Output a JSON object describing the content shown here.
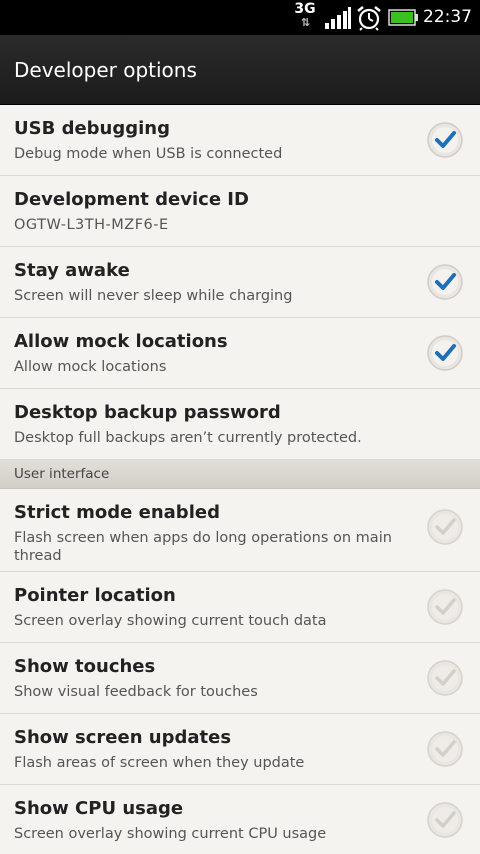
{
  "status_bar": {
    "network": "3G",
    "time": "22:37",
    "icons": [
      "network-3g-icon",
      "signal-icon",
      "alarm-icon",
      "battery-icon"
    ]
  },
  "header": {
    "title": "Developer options"
  },
  "items": [
    {
      "title": "USB debugging",
      "summary": "Debug mode when USB is connected",
      "checked": true
    },
    {
      "title": "Development device ID",
      "summary": "OGTW-L3TH-MZF6-E",
      "checked": null
    },
    {
      "title": "Stay awake",
      "summary": "Screen will never sleep while charging",
      "checked": true
    },
    {
      "title": "Allow mock locations",
      "summary": "Allow mock locations",
      "checked": true
    },
    {
      "title": "Desktop backup password",
      "summary": "Desktop full backups aren’t currently protected.",
      "checked": null
    }
  ],
  "section": {
    "label": "User interface"
  },
  "ui_items": [
    {
      "title": "Strict mode enabled",
      "summary": "Flash screen when apps do long operations on main thread",
      "checked": false
    },
    {
      "title": "Pointer location",
      "summary": "Screen overlay showing current touch data",
      "checked": false
    },
    {
      "title": "Show touches",
      "summary": "Show visual feedback for touches",
      "checked": false
    },
    {
      "title": "Show screen updates",
      "summary": "Flash areas of screen when they update",
      "checked": false
    },
    {
      "title": "Show CPU usage",
      "summary": "Screen overlay showing current CPU usage",
      "checked": false
    }
  ],
  "colors": {
    "check_blue": "#1e6fb8",
    "check_disabled": "#c8c5c0"
  }
}
